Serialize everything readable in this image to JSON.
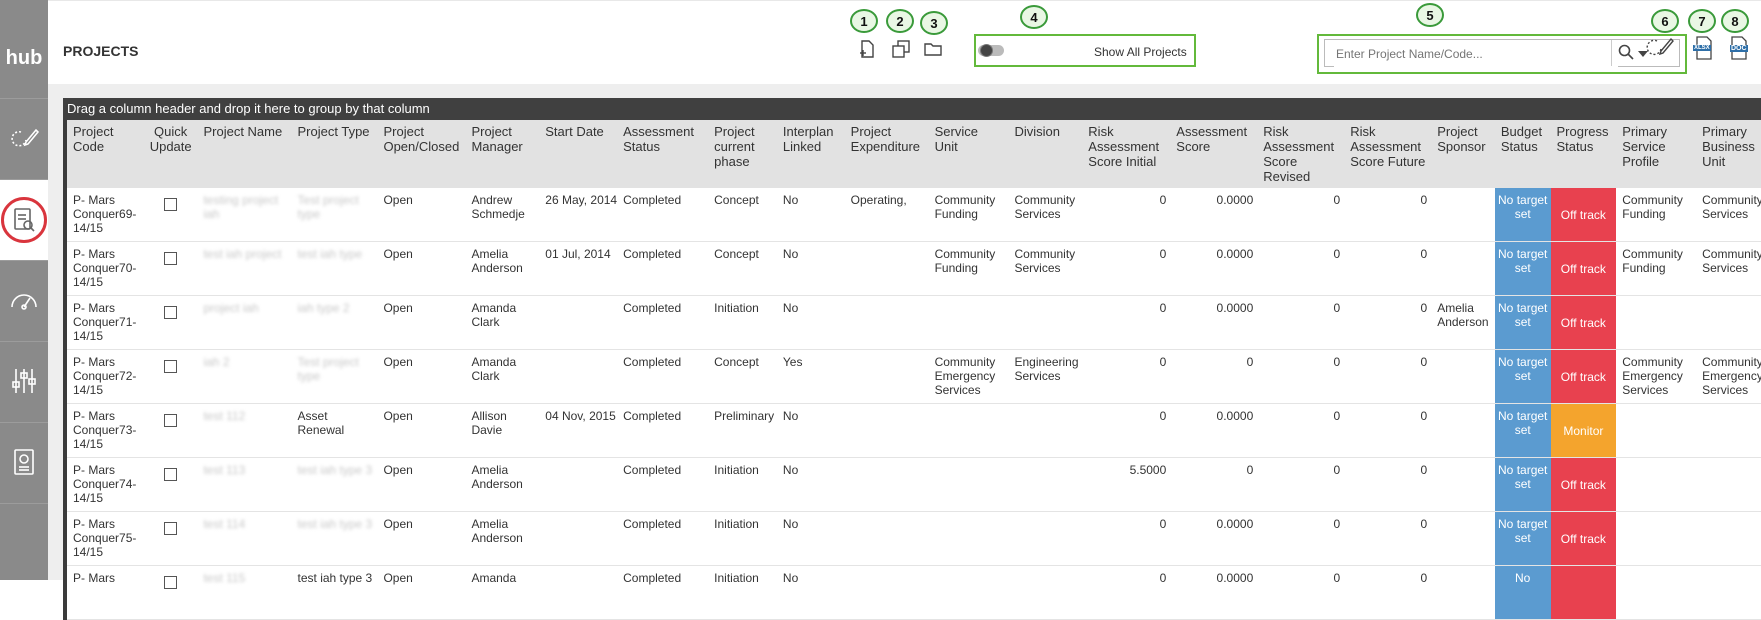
{
  "app": {
    "logo": "hub"
  },
  "header": {
    "title": "PROJECTS",
    "toggle_label": "Show All Projects",
    "search_placeholder": "Enter Project Name/Code...",
    "badges": [
      "1",
      "2",
      "3",
      "4",
      "5",
      "6",
      "7",
      "8"
    ],
    "icons": {
      "xlsx": "XLSX",
      "doc": "DOC"
    }
  },
  "grid": {
    "group_hint": "Drag a column header and drop it here to group by that column",
    "columns": [
      "Project Code",
      "Quick Update",
      "Project Name",
      "Project Type",
      "Project Open/Closed",
      "Project Manager",
      "Start Date",
      "Assessment Status",
      "Project current phase",
      "Interplan Linked",
      "Project Expenditure",
      "Service Unit",
      "Division",
      "Risk Assessment Score Initial",
      "Assessment Score",
      "Risk Assessment Score Revised",
      "Risk Assessment Score Future",
      "Project Sponsor",
      "Budget Status",
      "Progress Status",
      "Primary Service Profile",
      "Primary Business Unit"
    ],
    "rows": [
      {
        "code": "P- Mars Conquer69-14/15",
        "name": "testing project iah",
        "type": "Test project type",
        "oc": "Open",
        "manager": "Andrew Schmedje",
        "start": "26 May, 2014",
        "astatus": "Completed",
        "phase": "Concept",
        "interplan": "No",
        "expenditure": "Operating,",
        "unit": "Community Funding",
        "division": "Community Services",
        "risk_initial": "0",
        "ascore": "0.0000",
        "risk_revised": "0",
        "risk_future": "0",
        "sponsor": "",
        "budget": "No target set",
        "progress": "Off track",
        "profile": "Community Funding",
        "business": "Community Services"
      },
      {
        "code": "P- Mars Conquer70-14/15",
        "name": "test iah project",
        "type": "test iah type",
        "oc": "Open",
        "manager": "Amelia Anderson",
        "start": "01 Jul, 2014",
        "astatus": "Completed",
        "phase": "Concept",
        "interplan": "No",
        "expenditure": "",
        "unit": "Community Funding",
        "division": "Community Services",
        "risk_initial": "0",
        "ascore": "0.0000",
        "risk_revised": "0",
        "risk_future": "0",
        "sponsor": "",
        "budget": "No target set",
        "progress": "Off track",
        "profile": "Community Funding",
        "business": "Community Services"
      },
      {
        "code": "P- Mars Conquer71-14/15",
        "name": "project iah",
        "type": "iah type 2",
        "oc": "Open",
        "manager": "Amanda Clark",
        "start": "",
        "astatus": "Completed",
        "phase": "Initiation",
        "interplan": "No",
        "expenditure": "",
        "unit": "",
        "division": "",
        "risk_initial": "0",
        "ascore": "0.0000",
        "risk_revised": "0",
        "risk_future": "0",
        "sponsor": "Amelia Anderson",
        "budget": "No target set",
        "progress": "Off track",
        "profile": "",
        "business": ""
      },
      {
        "code": "P- Mars Conquer72-14/15",
        "name": "iah 2",
        "type": "Test project type",
        "oc": "Open",
        "manager": "Amanda Clark",
        "start": "",
        "astatus": "Completed",
        "phase": "Concept",
        "interplan": "Yes",
        "expenditure": "",
        "unit": "Community Emergency Services",
        "division": "Engineering Services",
        "risk_initial": "0",
        "ascore": "0",
        "risk_revised": "0",
        "risk_future": "0",
        "sponsor": "",
        "budget": "No target set",
        "progress": "Off track",
        "profile": "Community Emergency Services",
        "business": "Community Emergency Services"
      },
      {
        "code": "P- Mars Conquer73-14/15",
        "name": "test 112",
        "type": "Asset Renewal",
        "oc": "Open",
        "manager": "Allison Davie",
        "start": "04 Nov, 2015",
        "astatus": "Completed",
        "phase": "Preliminary",
        "interplan": "No",
        "expenditure": "",
        "unit": "",
        "division": "",
        "risk_initial": "0",
        "ascore": "0.0000",
        "risk_revised": "0",
        "risk_future": "0",
        "sponsor": "",
        "budget": "No target set",
        "progress": "Monitor",
        "profile": "",
        "business": ""
      },
      {
        "code": "P- Mars Conquer74-14/15",
        "name": "test 113",
        "type": "test iah type 3",
        "oc": "Open",
        "manager": "Amelia Anderson",
        "start": "",
        "astatus": "Completed",
        "phase": "Initiation",
        "interplan": "No",
        "expenditure": "",
        "unit": "",
        "division": "",
        "risk_initial": "5.5000",
        "ascore": "0",
        "risk_revised": "0",
        "risk_future": "0",
        "sponsor": "",
        "budget": "No target set",
        "progress": "Off track",
        "profile": "",
        "business": ""
      },
      {
        "code": "P- Mars Conquer75-14/15",
        "name": "test 114",
        "type": "test iah type 3",
        "oc": "Open",
        "manager": "Amelia Anderson",
        "start": "",
        "astatus": "Completed",
        "phase": "Initiation",
        "interplan": "No",
        "expenditure": "",
        "unit": "",
        "division": "",
        "risk_initial": "0",
        "ascore": "0.0000",
        "risk_revised": "0",
        "risk_future": "0",
        "sponsor": "",
        "budget": "No target set",
        "progress": "Off track",
        "profile": "",
        "business": ""
      },
      {
        "code": "P- Mars",
        "name": "test 115",
        "type": "test iah type 3",
        "oc": "Open",
        "manager": "Amanda",
        "start": "",
        "astatus": "Completed",
        "phase": "Initiation",
        "interplan": "No",
        "expenditure": "",
        "unit": "",
        "division": "",
        "risk_initial": "0",
        "ascore": "0.0000",
        "risk_revised": "0",
        "risk_future": "0",
        "sponsor": "",
        "budget": "No",
        "progress": "",
        "profile": "",
        "business": ""
      }
    ]
  }
}
